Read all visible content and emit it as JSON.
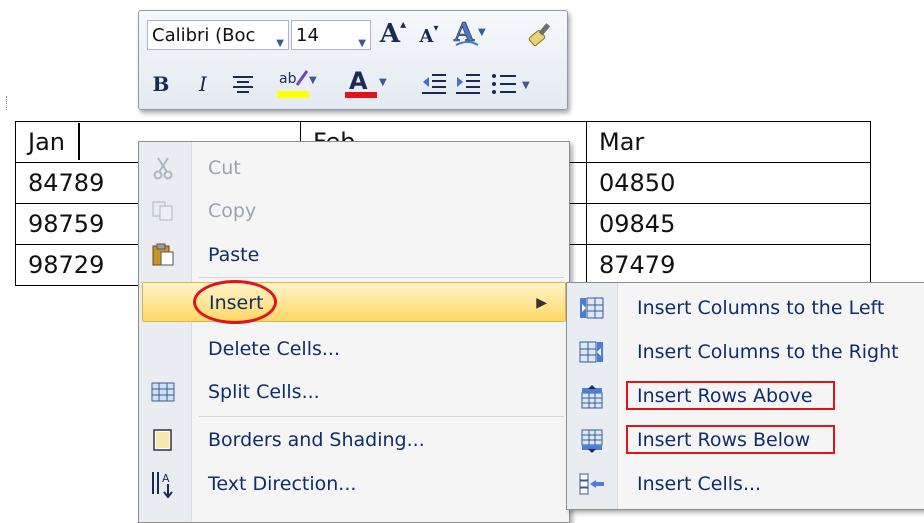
{
  "mini_toolbar": {
    "font_name": "Calibri (Boc",
    "font_size": "14",
    "grow_font_icon": "grow-font-icon",
    "shrink_font_icon": "shrink-font-icon",
    "styles_icon": "styles-icon",
    "format_painter_icon": "format-painter-icon",
    "bold": "B",
    "italic": "I",
    "highlight_color": "#ffff00",
    "font_color": "#e0141b"
  },
  "table": {
    "rows": [
      [
        "Jan",
        "Feb",
        "Mar"
      ],
      [
        "84789",
        "",
        "04850"
      ],
      [
        "98759",
        "",
        "09845"
      ],
      [
        "98729",
        "",
        "87479"
      ]
    ]
  },
  "context_menu": {
    "items": [
      {
        "label": "Cut",
        "icon": "scissors-icon",
        "enabled": false
      },
      {
        "label": "Copy",
        "icon": "copy-icon",
        "enabled": false
      },
      {
        "label": "Paste",
        "icon": "paste-icon",
        "enabled": true
      },
      {
        "label": "Insert",
        "icon": "",
        "enabled": true,
        "highlighted": true,
        "has_submenu": true
      },
      {
        "label": "Delete Cells...",
        "icon": "",
        "enabled": true
      },
      {
        "label": "Split Cells...",
        "icon": "split-cells-icon",
        "enabled": true
      },
      {
        "label": "Borders and Shading...",
        "icon": "borders-shading-icon",
        "enabled": true
      },
      {
        "label": "Text Direction...",
        "icon": "text-direction-icon",
        "enabled": true
      }
    ]
  },
  "insert_submenu": {
    "items": [
      {
        "label": "Insert Columns to the Left",
        "icon": "insert-columns-left-icon"
      },
      {
        "label": "Insert Columns to the Right",
        "icon": "insert-columns-right-icon"
      },
      {
        "label": "Insert Rows Above",
        "icon": "insert-rows-above-icon",
        "highlighted_box": true
      },
      {
        "label": "Insert Rows Below",
        "icon": "insert-rows-below-icon",
        "highlighted_box": true
      },
      {
        "label": "Insert Cells...",
        "icon": "insert-cells-icon"
      }
    ]
  },
  "annotation_color": "#e0141b"
}
